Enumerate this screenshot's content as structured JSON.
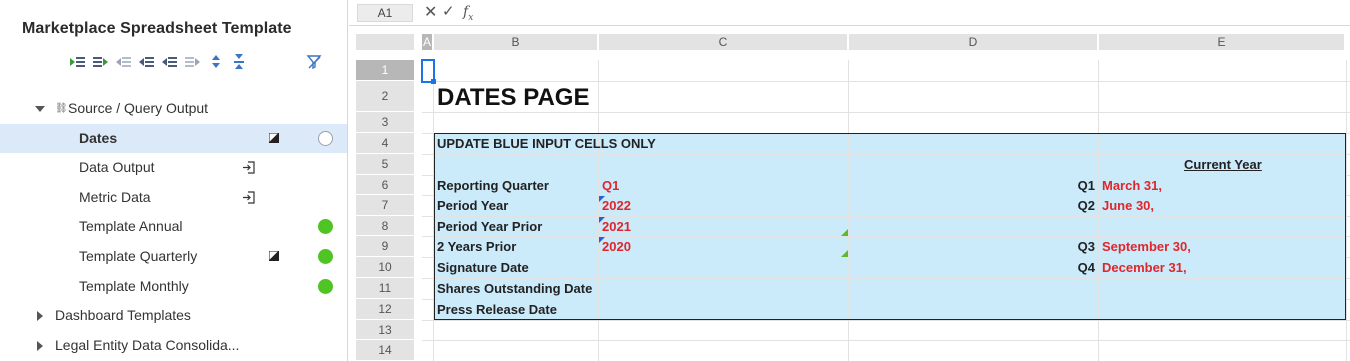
{
  "panel": {
    "title": "Marketplace Spreadsheet Template",
    "toolbar_icons": [
      "add-row-above-icon",
      "add-row-below-icon",
      "outdent-icon",
      "indent-icon",
      "move-left-icon",
      "move-right-icon",
      "expand-all-icon",
      "collapse-all-icon"
    ],
    "filter_icon": "clear-filter-icon",
    "tree": [
      {
        "label": "Source / Query Output",
        "expanded": true,
        "link_glyph": "⛓",
        "level": 0
      },
      {
        "label": "Dates",
        "selected": true,
        "icon": "flag-icon",
        "status": "empty",
        "level": 1
      },
      {
        "label": "Data Output",
        "icon": "import-icon",
        "level": 1
      },
      {
        "label": "Metric Data",
        "icon": "import-icon",
        "level": 1
      },
      {
        "label": "Template Annual",
        "status": "ok",
        "level": 1
      },
      {
        "label": "Template Quarterly",
        "icon": "flag-icon",
        "status": "ok",
        "level": 1
      },
      {
        "label": "Template Monthly",
        "status": "ok",
        "level": 1
      },
      {
        "label": "Dashboard Templates",
        "expanded": false,
        "level": 0
      },
      {
        "label": "Legal Entity Data Consolida...",
        "expanded": false,
        "level": 0
      }
    ]
  },
  "formula_bar": {
    "cell_ref": "A1",
    "cancel": "✕",
    "confirm": "✓",
    "func": "f",
    "func_sub": "x"
  },
  "sheet": {
    "columns": [
      "A",
      "B",
      "C",
      "D",
      "E"
    ],
    "rows": [
      "1",
      "2",
      "3",
      "4",
      "5",
      "6",
      "7",
      "8",
      "9",
      "10",
      "11",
      "12",
      "13",
      "14"
    ],
    "selected_cell": "A1",
    "title": "DATES PAGE",
    "banner": "UPDATE BLUE INPUT CELLS ONLY",
    "current_year_header": "Current Year",
    "labels": {
      "r6": "Reporting Quarter",
      "r7": "Period Year",
      "r8": "Period Year Prior",
      "r9": "2 Years Prior",
      "r10": "Signature Date",
      "r11": "Shares Outstanding Date",
      "r12": "Press Release Date"
    },
    "inputs": {
      "r6": "Q1",
      "r7": "2022",
      "r8": "2021",
      "r9": "2020"
    },
    "quarters": {
      "r6": {
        "q": "Q1",
        "date": "March 31,"
      },
      "r7": {
        "q": "Q2",
        "date": "June 30,"
      },
      "r9": {
        "q": "Q3",
        "date": "September 30,"
      },
      "r10": {
        "q": "Q4",
        "date": "December 31,"
      }
    },
    "colors": {
      "input_fill": "#cbeafa",
      "input_text": "#e0262b",
      "header_fill": "#e3e3e3",
      "selection": "#1a73e8"
    }
  }
}
